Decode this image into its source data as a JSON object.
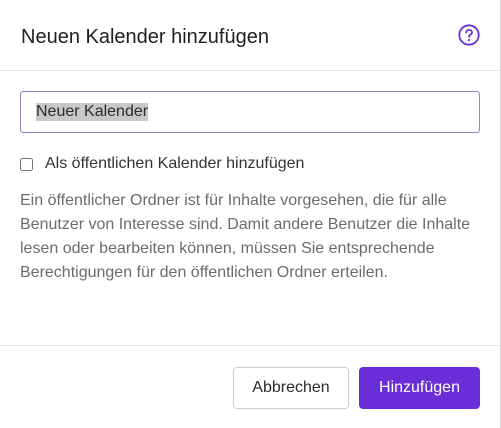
{
  "dialog": {
    "title": "Neuen Kalender hinzufügen",
    "help_icon": "question-circle-icon",
    "name_input": {
      "value": "Neuer Kalender"
    },
    "public_checkbox": {
      "label": "Als öffentlichen Kalender hinzufügen",
      "checked": false
    },
    "description": "Ein öffentlicher Ordner ist für Inhalte vorgesehen, die für alle Benutzer von Interesse sind. Damit andere Benutzer die Inhalte lesen oder bearbeiten können, müssen Sie entsprechende Berechtigungen für den öffentlichen Ordner erteilen.",
    "buttons": {
      "cancel_label": "Abbrechen",
      "add_label": "Hinzufügen"
    }
  },
  "colors": {
    "accent": "#6a2ed8",
    "input_border": "#8e84c8"
  }
}
